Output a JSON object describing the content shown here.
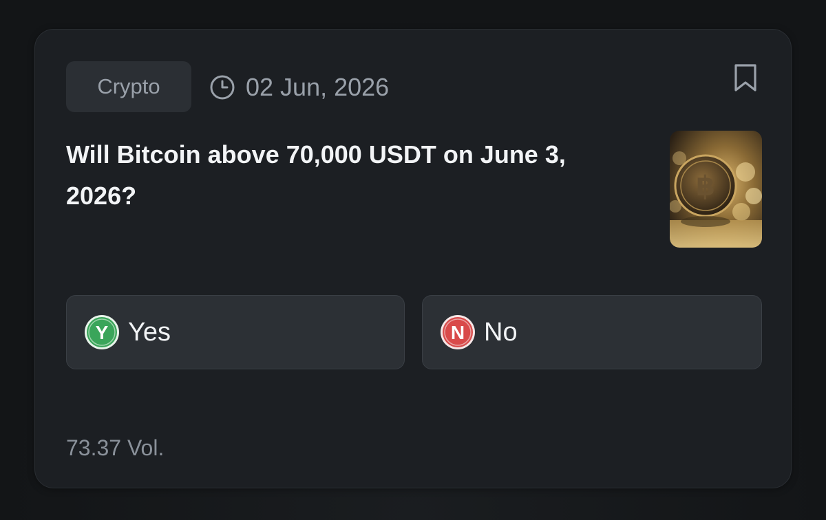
{
  "market": {
    "category": "Crypto",
    "date": "02 Jun, 2026",
    "question": "Will Bitcoin above 70,000 USDT on June 3, 2026?",
    "volume": "73.37 Vol."
  },
  "options": {
    "yes": {
      "badge_letter": "Y",
      "label": "Yes",
      "color": "#3aa55a"
    },
    "no": {
      "badge_letter": "N",
      "label": "No",
      "color": "#d94a4a"
    }
  },
  "icons": {
    "clock": "clock-icon",
    "bookmark": "bookmark-icon",
    "thumbnail": "bitcoin-coin-image"
  },
  "colors": {
    "card_bg": "#1c1f23",
    "tag_bg": "#2b2f34",
    "button_bg": "#2c3035",
    "text_primary": "#f2f4f6",
    "text_muted": "#9aa1aa"
  }
}
